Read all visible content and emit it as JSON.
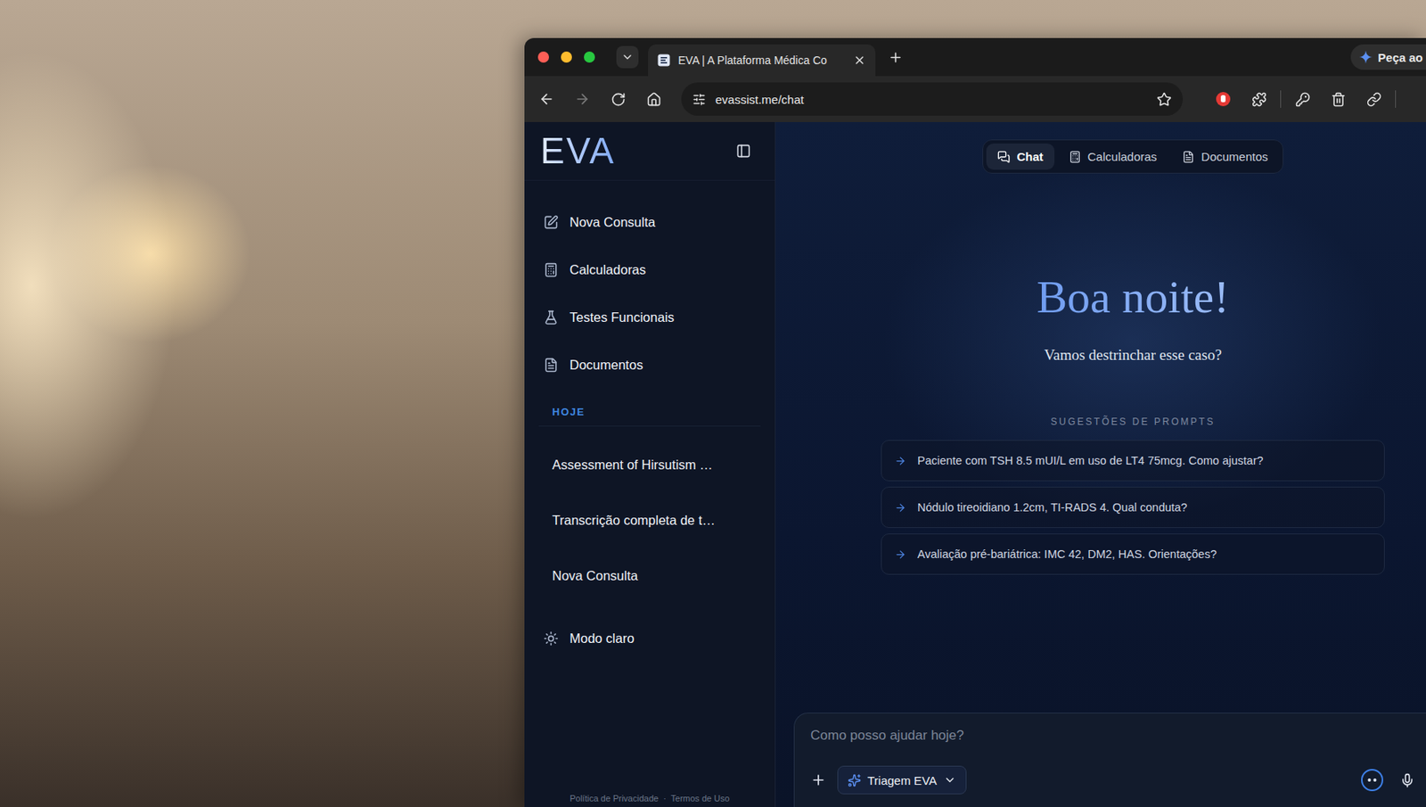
{
  "browser": {
    "tabs": [
      {
        "title": "EVA | A Plataforma Médica Co",
        "selected": true
      }
    ],
    "side_button": "Peça ao",
    "url": "evassist.me/chat"
  },
  "sidebar": {
    "logo": "EVA",
    "nav": [
      {
        "label": "Nova Consulta"
      },
      {
        "label": "Calculadoras"
      },
      {
        "label": "Testes Funcionais"
      },
      {
        "label": "Documentos"
      }
    ],
    "section": "HOJE",
    "history": [
      {
        "label": "Assessment of Hirsutism …"
      },
      {
        "label": "Transcrição completa de t…"
      },
      {
        "label": "Nova Consulta"
      }
    ],
    "theme_toggle": "Modo claro",
    "footer": {
      "links": [
        "Política de Privacidade",
        "Termos de Uso"
      ],
      "separator": "·"
    }
  },
  "main": {
    "tabs": [
      {
        "label": "Chat",
        "selected": true
      },
      {
        "label": "Calculadoras",
        "selected": false
      },
      {
        "label": "Documentos",
        "selected": false
      }
    ],
    "greeting": "Boa noite!",
    "subtitle": "Vamos destrinchar esse caso?",
    "suggestions_title": "SUGESTÕES DE PROMPTS",
    "suggestions": [
      "Paciente com TSH 8.5 mUI/L em uso de LT4 75mcg. Como ajustar?",
      "Nódulo tireoidiano 1.2cm, TI-RADS 4. Qual conduta?",
      "Avaliação pré-bariátrica: IMC 42, DM2, HAS. Orientações?"
    ]
  },
  "composer": {
    "placeholder": "Como posso ajudar hoje?",
    "mode": "Triagem EVA"
  }
}
